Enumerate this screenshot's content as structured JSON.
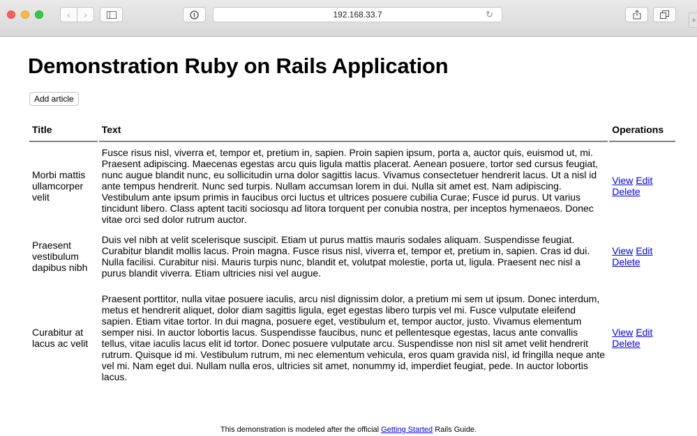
{
  "browser": {
    "address": "192.168.33.7",
    "icons": [
      "back-icon",
      "forward-icon",
      "sidebar-icon",
      "privacy-icon",
      "reload-icon",
      "share-icon",
      "tabs-icon",
      "new-tab-icon"
    ],
    "colors": {
      "red": "#fc605c",
      "yellow": "#fdbc40",
      "green": "#34c84a"
    }
  },
  "page": {
    "title": "Demonstration Ruby on Rails Application",
    "add_button": "Add article"
  },
  "table": {
    "headers": {
      "title": "Title",
      "text": "Text",
      "operations": "Operations"
    },
    "rows": [
      {
        "title": "Morbi mattis ullamcorper velit",
        "text": "Fusce risus nisl, viverra et, tempor et, pretium in, sapien. Proin sapien ipsum, porta a, auctor quis, euismod ut, mi. Praesent adipiscing. Maecenas egestas arcu quis ligula mattis placerat. Aenean posuere, tortor sed cursus feugiat, nunc augue blandit nunc, eu sollicitudin urna dolor sagittis lacus. Vivamus consectetuer hendrerit lacus. Ut a nisl id ante tempus hendrerit. Nunc sed turpis. Nullam accumsan lorem in dui. Nulla sit amet est. Nam adipiscing. Vestibulum ante ipsum primis in faucibus orci luctus et ultrices posuere cubilia Curae; Fusce id purus. Ut varius tincidunt libero. Class aptent taciti sociosqu ad litora torquent per conubia nostra, per inceptos hymenaeos. Donec vitae orci sed dolor rutrum auctor.",
        "view": "View",
        "edit": "Edit",
        "delete": "Delete"
      },
      {
        "title": "Praesent vestibulum dapibus nibh",
        "text": "Duis vel nibh at velit scelerisque suscipit. Etiam ut purus mattis mauris sodales aliquam. Suspendisse feugiat. Curabitur blandit mollis lacus. Proin magna. Fusce risus nisl, viverra et, tempor et, pretium in, sapien. Cras id dui. Nulla facilisi. Curabitur nisi. Mauris turpis nunc, blandit et, volutpat molestie, porta ut, ligula. Praesent nec nisl a purus blandit viverra. Etiam ultricies nisi vel augue.",
        "view": "View",
        "edit": "Edit",
        "delete": "Delete"
      },
      {
        "title": "Curabitur at lacus ac velit",
        "text": "Praesent porttitor, nulla vitae posuere iaculis, arcu nisl dignissim dolor, a pretium mi sem ut ipsum. Donec interdum, metus et hendrerit aliquet, dolor diam sagittis ligula, eget egestas libero turpis vel mi. Fusce vulputate eleifend sapien. Etiam vitae tortor. In dui magna, posuere eget, vestibulum et, tempor auctor, justo. Vivamus elementum semper nisi. In auctor lobortis lacus. Suspendisse faucibus, nunc et pellentesque egestas, lacus ante convallis tellus, vitae iaculis lacus elit id tortor. Donec posuere vulputate arcu. Suspendisse non nisl sit amet velit hendrerit rutrum. Quisque id mi. Vestibulum rutrum, mi nec elementum vehicula, eros quam gravida nisl, id fringilla neque ante vel mi. Nam eget dui. Nullam nulla eros, ultricies sit amet, nonummy id, imperdiet feugiat, pede. In auctor lobortis lacus.",
        "view": "View",
        "edit": "Edit",
        "delete": "Delete"
      }
    ]
  },
  "footer": {
    "prefix": "This demonstration is modeled after the official ",
    "link": "Getting Started",
    "suffix": " Rails Guide."
  }
}
